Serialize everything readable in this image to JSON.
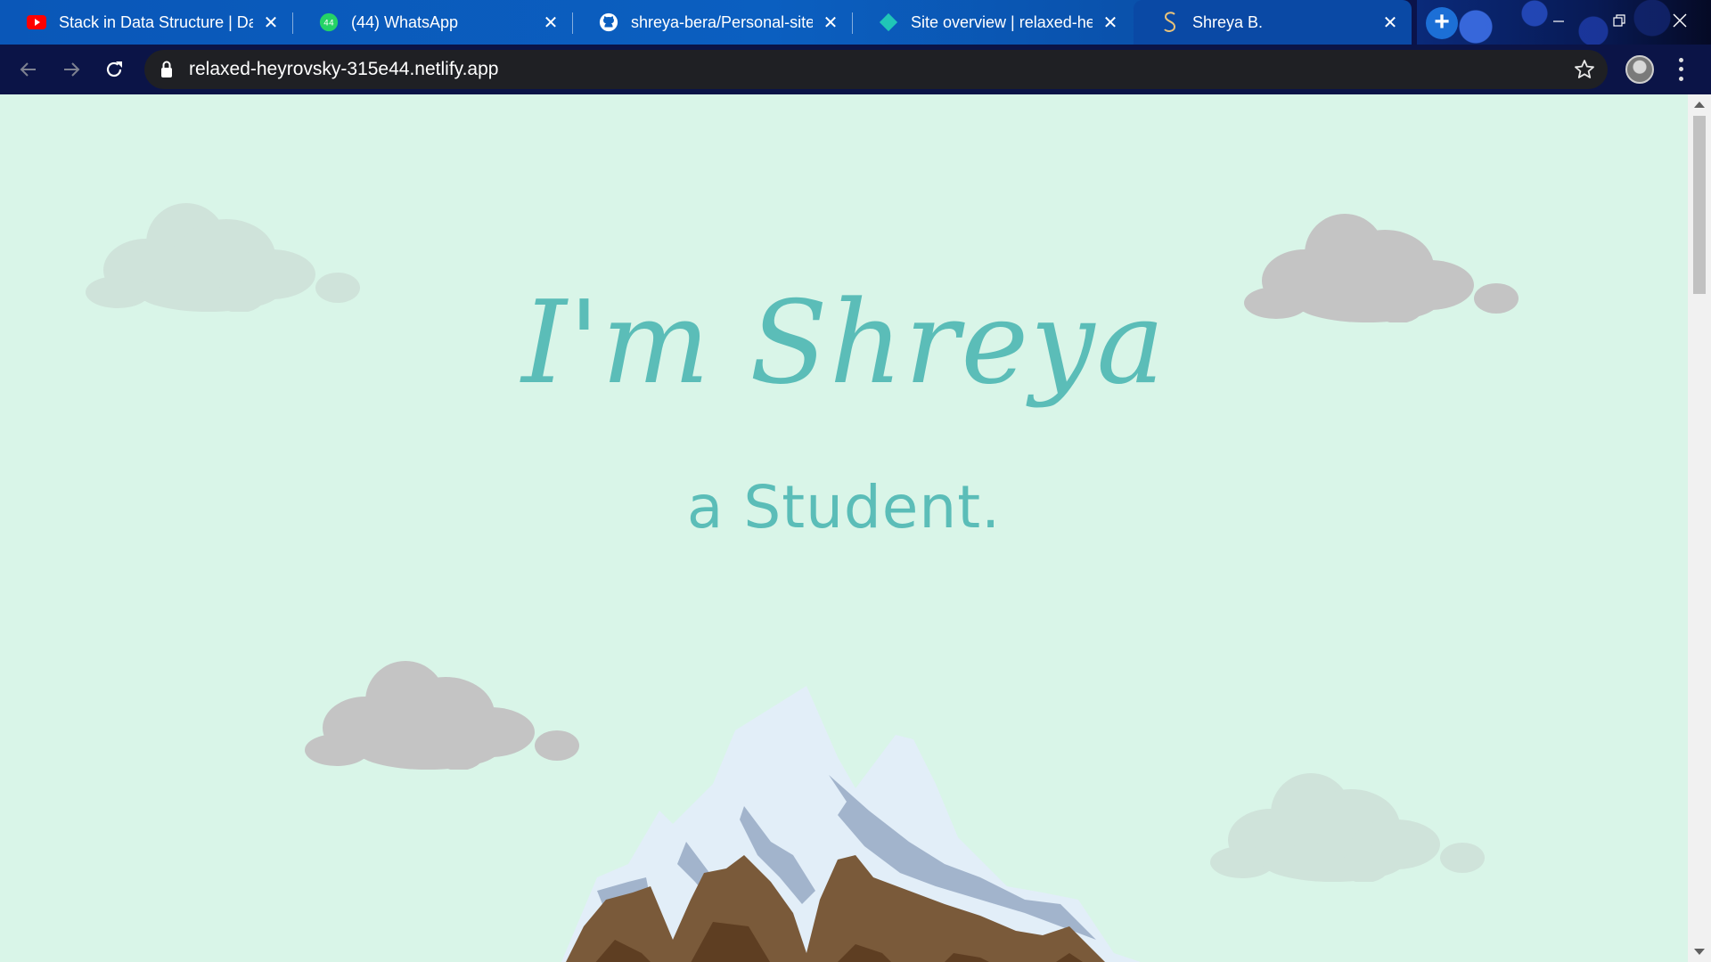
{
  "browser": {
    "tabs": [
      {
        "title": "Stack in Data Structure | Data",
        "favicon": "youtube-icon"
      },
      {
        "title": "(44) WhatsApp",
        "favicon": "whatsapp-icon"
      },
      {
        "title": "shreya-bera/Personal-site",
        "favicon": "github-icon"
      },
      {
        "title": "Site overview | relaxed-heyrovsky",
        "favicon": "netlify-icon"
      },
      {
        "title": "Shreya B.",
        "favicon": "site-s-icon",
        "active": true
      }
    ],
    "whatsapp_badge": "44",
    "new_tab_label": "+",
    "address": {
      "url": "relaxed-heyrovsky-315e44.netlify.app"
    }
  },
  "page": {
    "heading": "I'm Shreya",
    "subheading": "a Student."
  },
  "colors": {
    "page_bg": "#d9f5e8",
    "accent_teal": "#5bbdb8",
    "cloud_grey": "#c4c4c4",
    "cloud_light": "#cfe3da"
  }
}
